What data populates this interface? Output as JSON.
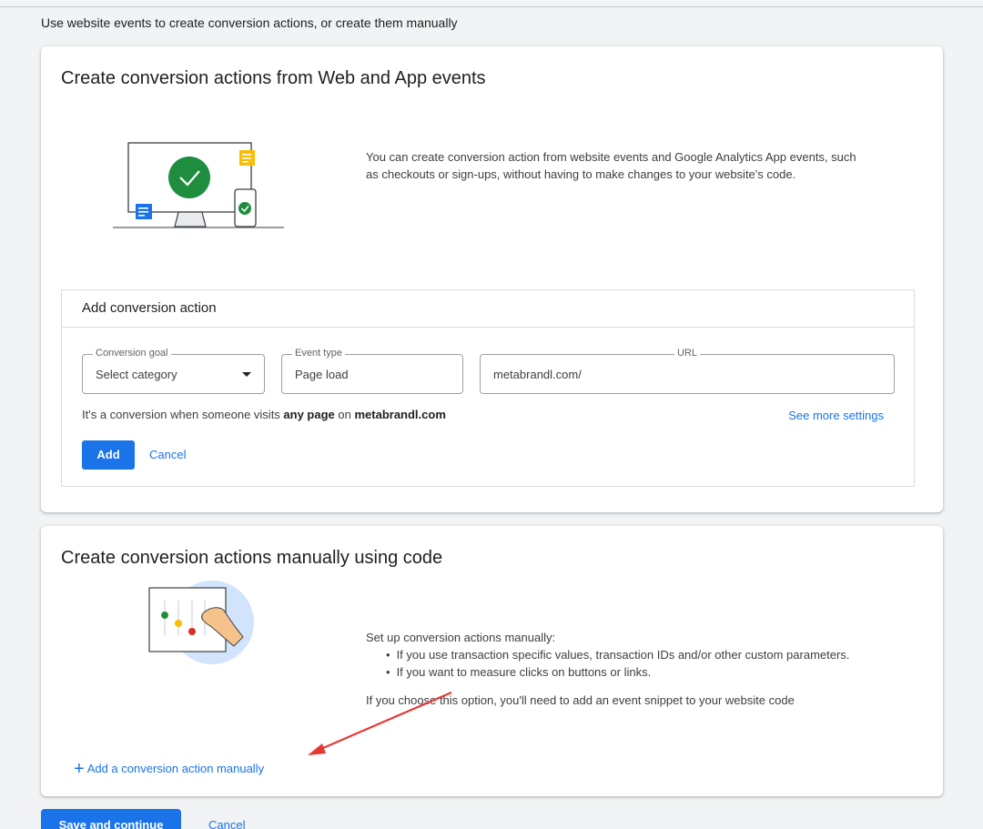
{
  "intro": "Use website events to create conversion actions, or create them manually",
  "web_card": {
    "title": "Create conversion actions from Web and App events",
    "description": "You can create conversion action from website events and Google Analytics App events, such as checkouts or sign-ups, without having to make changes to your website's code.",
    "panel_title": "Add conversion action",
    "fields": {
      "goal_label": "Conversion goal",
      "goal_value": "Select category",
      "event_label": "Event type",
      "event_value": "Page load",
      "url_label": "URL",
      "url_value": "metabrandl.com/"
    },
    "hint_prefix": "It's a conversion when someone visits ",
    "hint_bold1": "any page",
    "hint_mid": " on ",
    "hint_bold2": "metabrandl.com",
    "see_more": "See more settings",
    "add_label": "Add",
    "cancel_label": "Cancel"
  },
  "manual_card": {
    "title": "Create conversion actions manually using code",
    "lead": "Set up conversion actions manually:",
    "bullets": [
      "If you use transaction specific values, transaction IDs and/or other custom parameters.",
      "If you want to measure clicks on buttons or links."
    ],
    "tail": "If you choose this option, you'll need to add an event snippet to your website code",
    "add_manual": "Add a conversion action manually"
  },
  "footer": {
    "save_label": "Save and continue",
    "cancel_label": "Cancel"
  },
  "colors": {
    "accent": "#1a73e8",
    "success": "#1e8e3e",
    "annotation_arrow": "#e53935"
  }
}
